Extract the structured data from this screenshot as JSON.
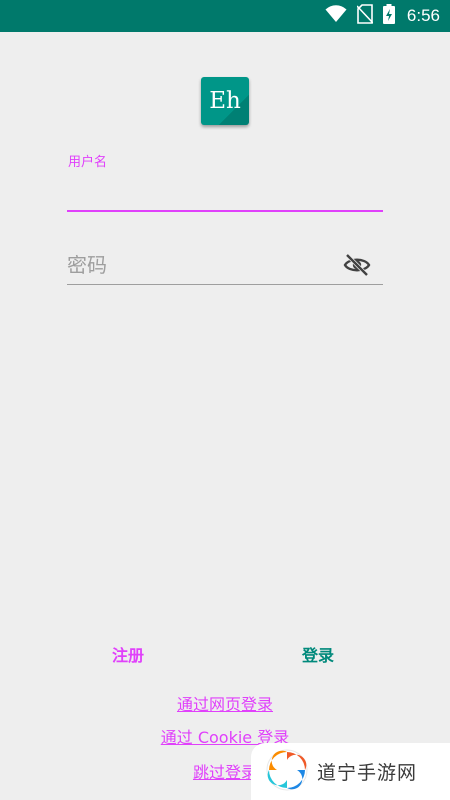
{
  "status_bar": {
    "time": "6:56",
    "icons": [
      "wifi-icon",
      "no-sim-icon",
      "battery-charging-icon"
    ]
  },
  "app": {
    "logo_text": "Eh"
  },
  "form": {
    "username_label": "用户名",
    "username_value": "",
    "password_placeholder": "密码",
    "password_value": "",
    "password_toggle_icon": "eye-off-icon"
  },
  "actions": {
    "register_label": "注册",
    "login_label": "登录",
    "web_login_label": "通过网页登录",
    "cookie_login_label": "通过 Cookie 登录",
    "skip_login_label": "跳过登录"
  },
  "watermark": {
    "text": "道宁手游网",
    "icon": "swirl-logo-icon"
  },
  "colors": {
    "status_bar": "#00796b",
    "accent": "#e040fb",
    "primary": "#00897b",
    "background": "#eeeeee"
  }
}
